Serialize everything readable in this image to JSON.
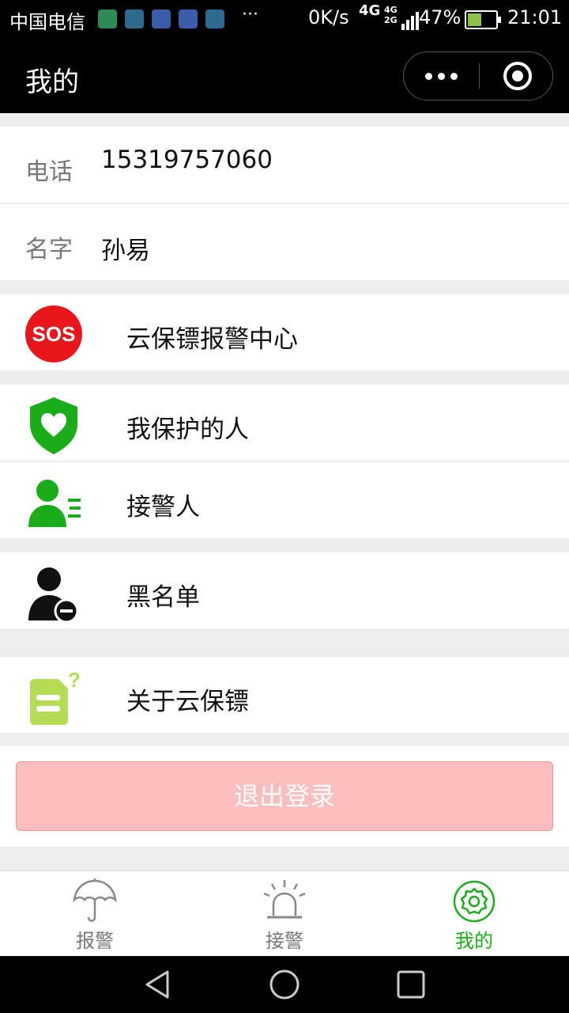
{
  "status_bar": {
    "carrier": "中国电信",
    "more": "···",
    "net_speed": "0K/s",
    "network_a": "4G",
    "network_b": "4G",
    "network_c": "2G",
    "battery": "47%",
    "time": "21:01",
    "battery_color": "#8bc34a"
  },
  "nav": {
    "title": "我的"
  },
  "profile": {
    "phone_label": "电话",
    "phone_value": "15319757060",
    "name_label": "名字",
    "name_value": "孙易"
  },
  "menu": {
    "sos_badge": "SOS",
    "alarm_center": "云保镖报警中心",
    "protected_people": "我保护的人",
    "receivers": "接警人",
    "blacklist": "黑名单",
    "about": "关于云保镖"
  },
  "logout": {
    "label": "退出登录"
  },
  "tabs": [
    {
      "label": "报警",
      "icon": "umbrella-icon"
    },
    {
      "label": "接警",
      "icon": "alarm-light-icon"
    },
    {
      "label": "我的",
      "icon": "gear-icon"
    }
  ],
  "colors": {
    "accent": "#1aad19",
    "sos_red": "#e8161b",
    "logout_bg": "#fbbdbd",
    "about_icon": "#b5dc55"
  }
}
